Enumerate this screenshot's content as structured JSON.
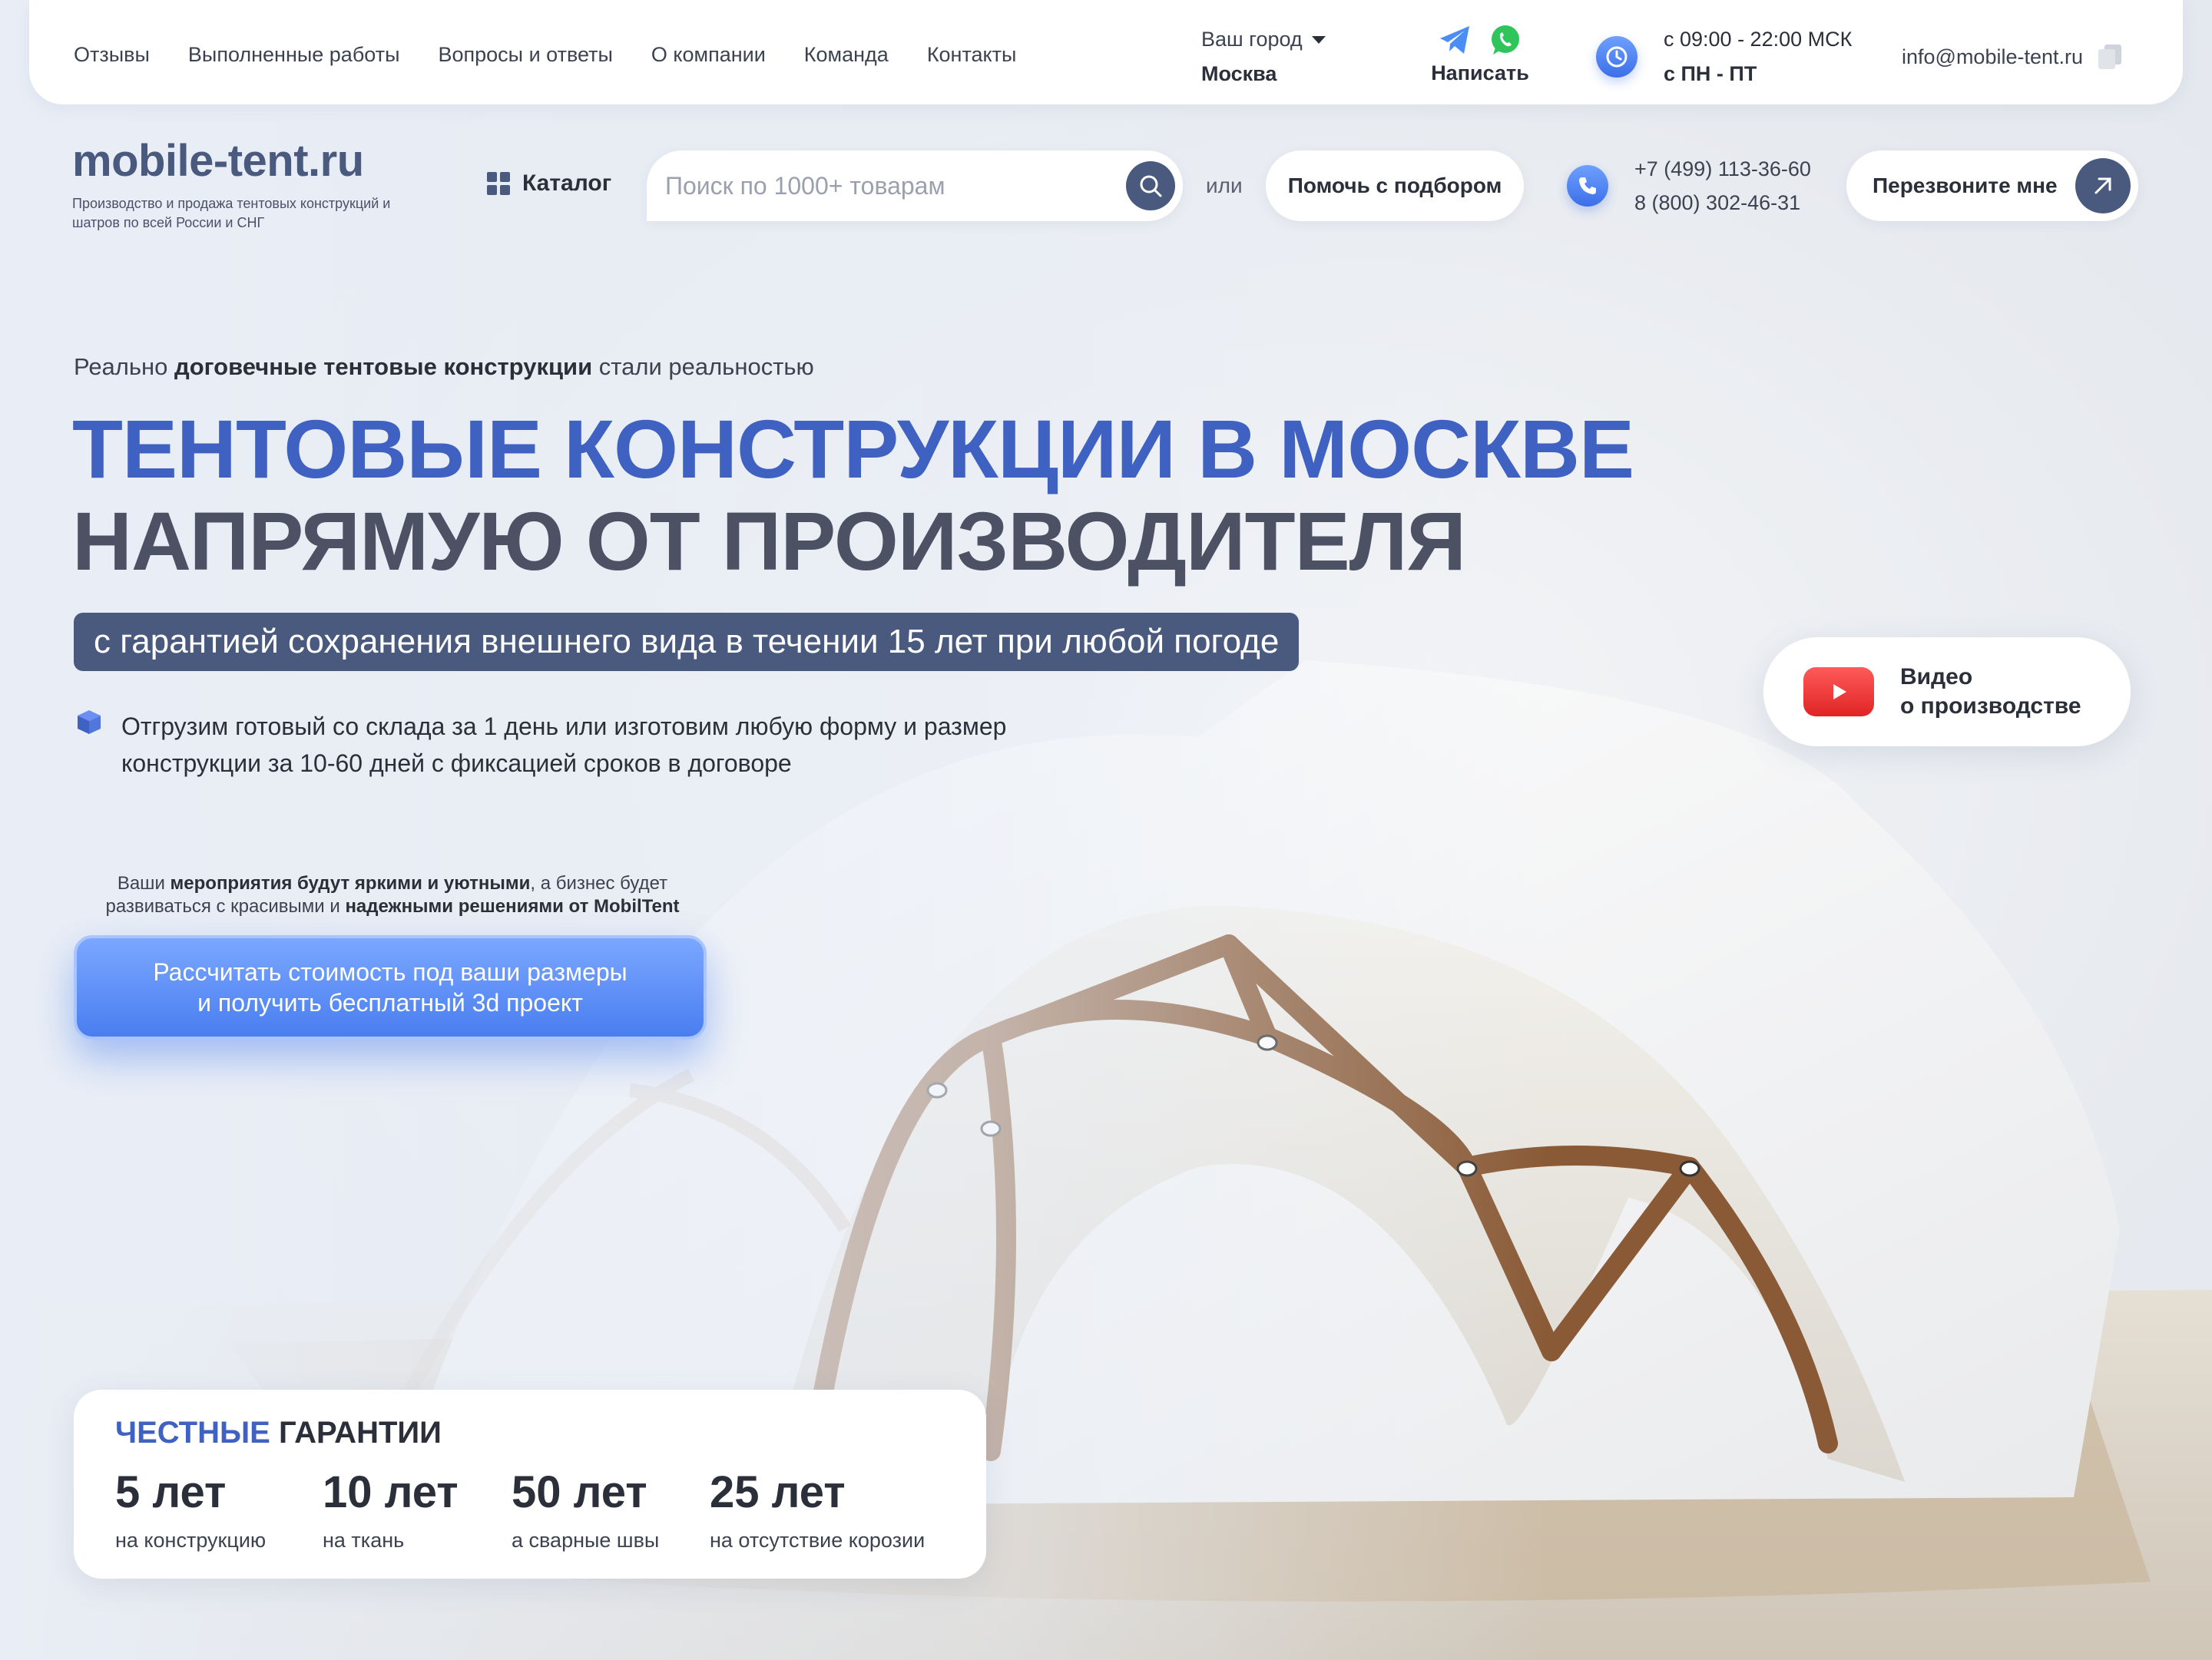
{
  "topnav": {
    "items": [
      "Отзывы",
      "Выполненные работы",
      "Вопросы и ответы",
      "О компании",
      "Команда",
      "Контакты"
    ]
  },
  "city": {
    "label": "Ваш город",
    "value": "Москва"
  },
  "messengers": {
    "label": "Написать",
    "icons": [
      "telegram-icon",
      "whatsapp-icon"
    ]
  },
  "hours": {
    "time": "с 09:00 - 22:00 МСК",
    "days": "с ПН - ПТ"
  },
  "email": "info@mobile-tent.ru",
  "logo": {
    "name": "mobile-tent.ru",
    "tagline": "Производство и продажа тентовых конструкций и шатров по всей России и СНГ"
  },
  "catalog_label": "Каталог",
  "search": {
    "placeholder": "Поиск по 1000+ товарам"
  },
  "or_label": "или",
  "help_button": "Помочь с подбором",
  "phones": [
    "+7 (499) 113-36-60",
    "8 (800) 302-46-31"
  ],
  "callback_button": "Перезвоните мне",
  "hero": {
    "eyebrow_pre": "Реально",
    "eyebrow_bold": "договечные тентовые конструкции",
    "eyebrow_post": "стали реальностью",
    "title_line1": "ТЕНТОВЫЕ КОНСТРУКЦИИ В МОСКВЕ",
    "title_line2": "НАПРЯМУЮ ОТ ПРОИЗВОДИТЕЛЯ",
    "badge": "с гарантией сохранения внешнего вида в течении 15 лет при любой погоде",
    "feature": "Отгрузим готовый со склада за 1 день или изготовим любую форму и размер конструкции за 10-60 дней с фиксацией сроков в договоре",
    "promo_pre": "Ваши",
    "promo_b1": "мероприятия будут яркими и уютными",
    "promo_mid": ", а бизнес будет развиваться с красивыми и",
    "promo_b2": "надежными решениями от MobilTent",
    "cta_line1": "Рассчитать стоимость под ваши размеры",
    "cta_line2": "и получить бесплатный 3d проект"
  },
  "video": {
    "line1": "Видео",
    "line2": "о производстве"
  },
  "guarantees": {
    "title_highlight": "ЧЕСТНЫЕ",
    "title_rest": "ГАРАНТИИ",
    "items": [
      {
        "value": "5 лет",
        "caption": "на конструкцию"
      },
      {
        "value": "10 лет",
        "caption": "на ткань"
      },
      {
        "value": "50 лет",
        "caption": "а сварные швы"
      },
      {
        "value": "25 лет",
        "caption": "на отсутствие корозии"
      }
    ]
  },
  "colors": {
    "accent": "#3f62c2",
    "dark_slate": "#4a5a7e",
    "cta": "#4a7ef0"
  }
}
